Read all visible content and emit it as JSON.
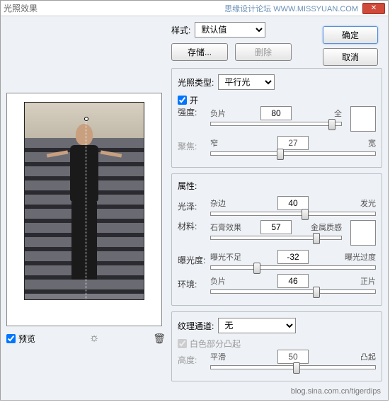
{
  "titlebar": {
    "title": "光照效果",
    "watermark": "思缘设计论坛  WWW.MISSYUAN.COM"
  },
  "buttons": {
    "ok": "确定",
    "cancel": "取消",
    "save": "存储...",
    "delete": "删除"
  },
  "style": {
    "label": "样式:",
    "value": "默认值"
  },
  "preview": {
    "checkbox_label": "预览"
  },
  "light": {
    "type_label": "光照类型:",
    "type_value": "平行光",
    "on_label": "开",
    "intensity": {
      "label": "强度:",
      "left": "负片",
      "right": "全",
      "value": "80",
      "pos": 90
    },
    "focus": {
      "label": "聚焦:",
      "left": "窄",
      "right": "宽",
      "value": "27",
      "pos": 40
    }
  },
  "props": {
    "header": "属性:",
    "gloss": {
      "label": "光泽:",
      "left": "杂边",
      "right": "发光",
      "value": "40",
      "pos": 55
    },
    "material": {
      "label": "材料:",
      "left": "石膏效果",
      "right": "金属质感",
      "value": "57",
      "pos": 78
    },
    "exposure": {
      "label": "曝光度:",
      "left": "曝光不足",
      "right": "曝光过度",
      "value": "-32",
      "pos": 26
    },
    "ambience": {
      "label": "环境:",
      "left": "负片",
      "right": "正片",
      "value": "46",
      "pos": 62
    }
  },
  "texture": {
    "label": "纹理通道:",
    "value": "无",
    "white_label": "白色部分凸起",
    "height": {
      "label": "高度:",
      "left": "平滑",
      "right": "凸起",
      "value": "50",
      "pos": 50
    }
  },
  "footer": "blog.sina.com.cn/tigerdips"
}
